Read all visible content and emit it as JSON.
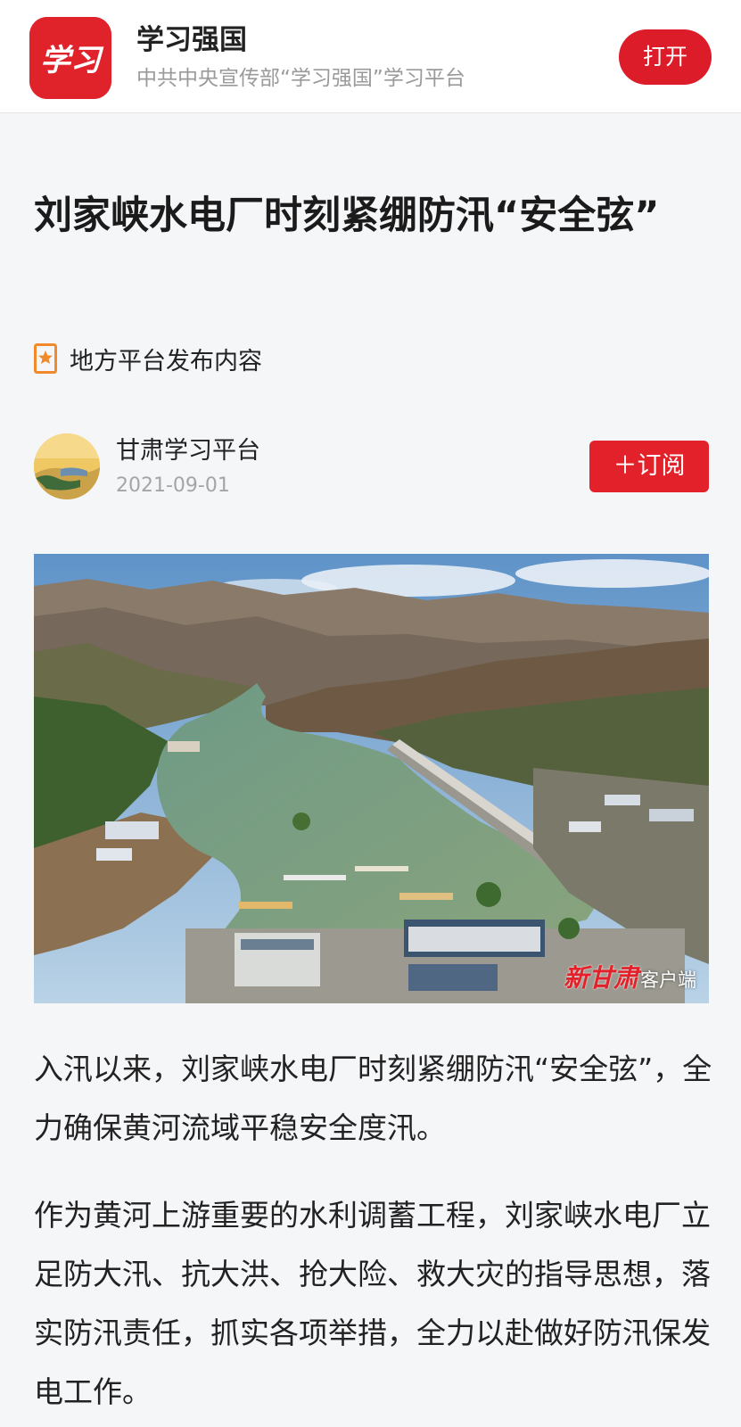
{
  "app_banner": {
    "logo_text": "学习",
    "name": "学习强国",
    "description": "中共中央宣传部“学习强国”学习平台",
    "open_button": "打开"
  },
  "article": {
    "title": "刘家峡水电厂时刻紧绷防汛“安全弦”",
    "source_tag": "地方平台发布内容",
    "author": {
      "name": "甘肃学习平台",
      "date": "2021-09-01",
      "subscribe_label": "＋订阅"
    },
    "image": {
      "watermark_logo": "新甘肃",
      "watermark_suffix": "客户端"
    },
    "paragraphs": [
      "入汛以来，刘家峡水电厂时刻紧绷防汛“安全弦”，全力确保黄河流域平稳安全度汛。",
      "作为黄河上游重要的水利调蓄工程，刘家峡水电厂立足防大汛、抗大洪、抢大险、救大灾的指导思想，落实防汛责任，抓实各项举措，全力以赴做好防汛保发电工作。"
    ]
  },
  "colors": {
    "brand_red": "#dd1c2a",
    "page_background": "#f5f6f8",
    "muted_text": "#9a9a9a"
  }
}
